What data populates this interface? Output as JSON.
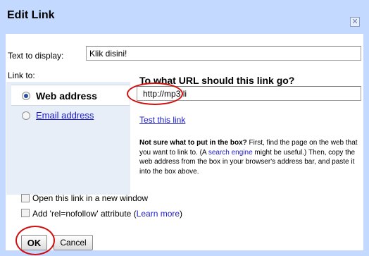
{
  "dialog": {
    "title": "Edit Link",
    "close_glyph": "✕"
  },
  "text_display": {
    "label": "Text to display:",
    "value": "Klik disini!"
  },
  "link_to": {
    "label": "Link to:",
    "options": [
      {
        "label": "Web address",
        "selected": true
      },
      {
        "label": "Email address",
        "selected": false
      }
    ]
  },
  "url": {
    "question": "To what URL should this link go?",
    "value": "http://mp3.li",
    "test_link": "Test this link"
  },
  "help": {
    "bold_lead": "Not sure what to put in the box?",
    "text_1": " First, find the page on the web that you want to link to. (A ",
    "search_engine_link": "search engine",
    "text_2": " might be useful.) Then, copy the web address from the box in your browser's address bar, and paste it into the box above."
  },
  "options": {
    "new_window_label": "Open this link in a new window",
    "nofollow_label_prefix": "Add 'rel=nofollow' attribute (",
    "learn_more_link": "Learn more",
    "nofollow_label_suffix": ")",
    "new_window_checked": false,
    "nofollow_checked": false
  },
  "buttons": {
    "ok": "OK",
    "cancel": "Cancel"
  },
  "colors": {
    "frame": "#c3d9ff",
    "link": "#1a1acc",
    "annotation": "#d01010"
  }
}
